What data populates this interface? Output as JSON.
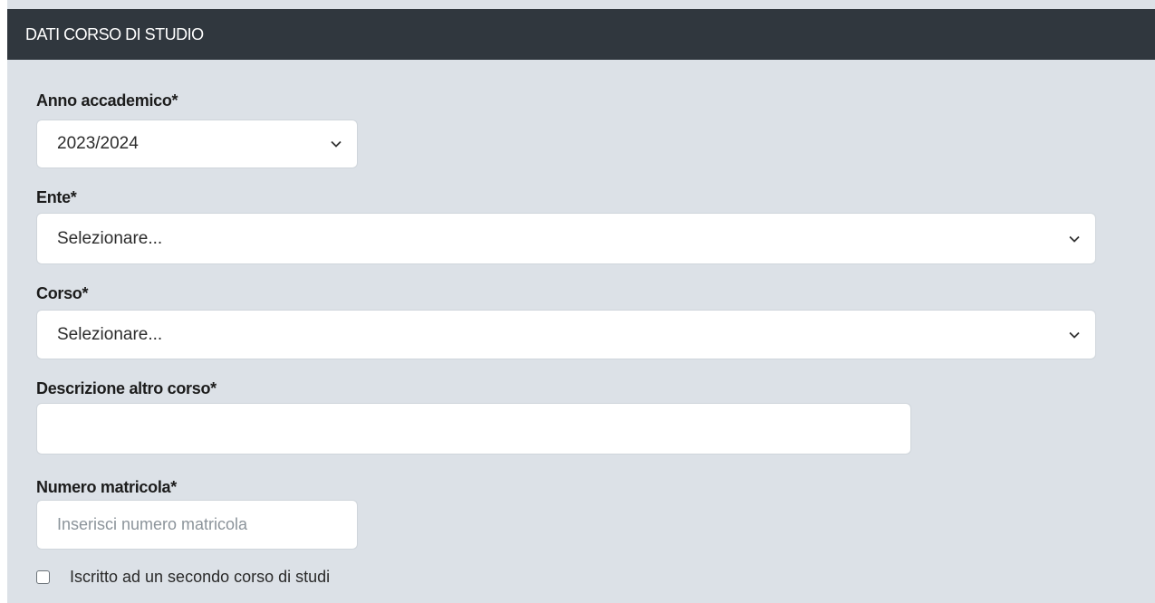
{
  "panel": {
    "title": "DATI CORSO DI STUDIO"
  },
  "fields": {
    "anno": {
      "label": "Anno accademico*",
      "value": "2023/2024"
    },
    "ente": {
      "label": "Ente*",
      "value": "Selezionare..."
    },
    "corso": {
      "label": "Corso*",
      "value": "Selezionare..."
    },
    "descrizione": {
      "label": "Descrizione altro corso*",
      "value": ""
    },
    "matricola": {
      "label": "Numero matricola*",
      "value": "",
      "placeholder": "Inserisci numero matricola"
    }
  },
  "checkbox": {
    "label": "Iscritto ad un secondo corso di studi",
    "checked": false
  },
  "icons": {
    "dropdown": "chevron-down-icon"
  }
}
